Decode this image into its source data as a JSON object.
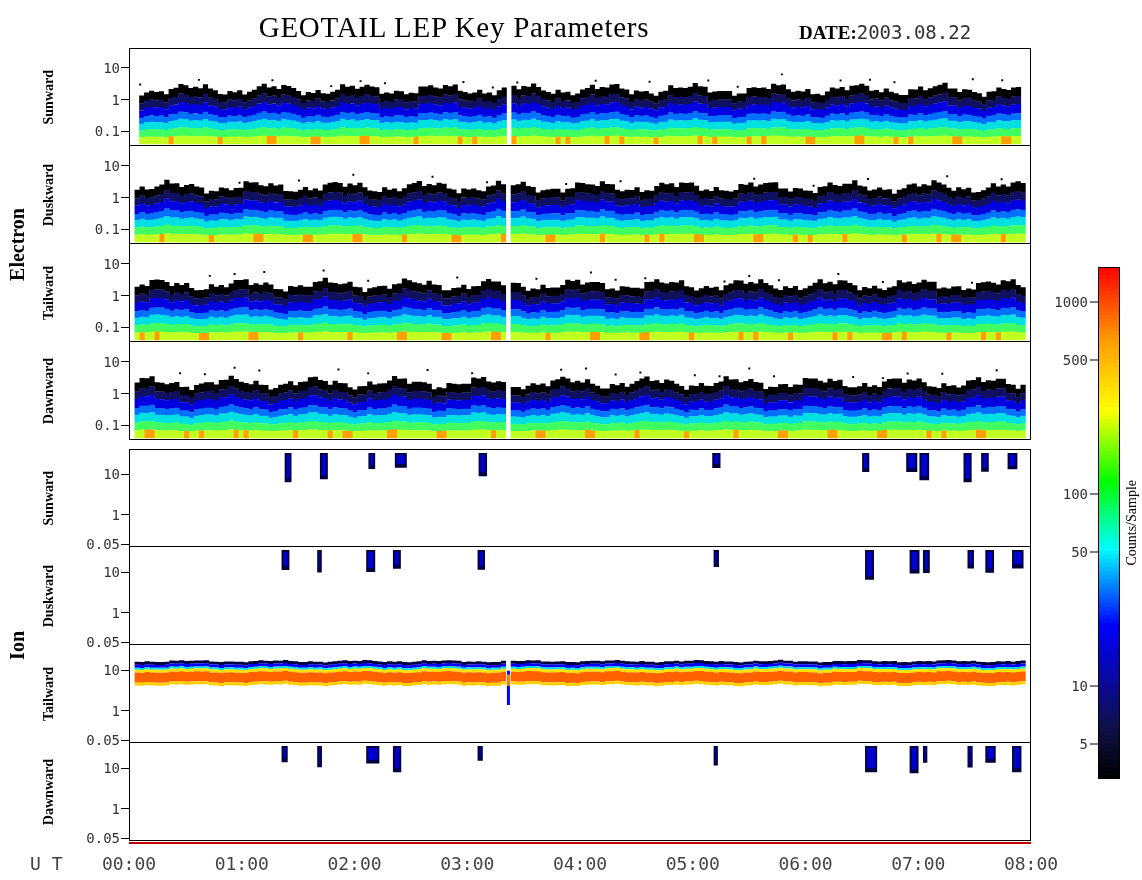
{
  "title": "GEOTAIL LEP Key Parameters",
  "date_label": "DATE:",
  "date_value": "2003.08.22",
  "species": [
    {
      "label": "Electron",
      "panels": [
        {
          "direction": "Sunward",
          "kind": "electron",
          "y_ticks": [
            "10",
            "1",
            "0.1"
          ]
        },
        {
          "direction": "Duskward",
          "kind": "electron",
          "y_ticks": [
            "10",
            "1",
            "0.1"
          ]
        },
        {
          "direction": "Tailward",
          "kind": "electron",
          "y_ticks": [
            "10",
            "1",
            "0.1"
          ]
        },
        {
          "direction": "Dawnward",
          "kind": "electron",
          "y_ticks": [
            "10",
            "1",
            "0.1"
          ]
        }
      ]
    },
    {
      "label": "Ion",
      "panels": [
        {
          "direction": "Sunward",
          "kind": "ion",
          "y_ticks": [
            "10",
            "1",
            "0.05"
          ]
        },
        {
          "direction": "Duskward",
          "kind": "ion",
          "y_ticks": [
            "10",
            "1",
            "0.05"
          ]
        },
        {
          "direction": "Tailward",
          "kind": "ion-beam",
          "y_ticks": [
            "10",
            "1",
            "0.05"
          ]
        },
        {
          "direction": "Dawnward",
          "kind": "ion",
          "y_ticks": [
            "10",
            "1",
            "0.05"
          ]
        }
      ]
    }
  ],
  "colorbar": {
    "label": "Counts/Sample",
    "ticks": [
      "1000",
      "500",
      "100",
      "50",
      "10",
      "5"
    ]
  },
  "time_axis": {
    "label": "U T",
    "ticks": [
      "00:00",
      "01:00",
      "02:00",
      "03:00",
      "04:00",
      "05:00",
      "06:00",
      "07:00",
      "08:00"
    ]
  }
}
